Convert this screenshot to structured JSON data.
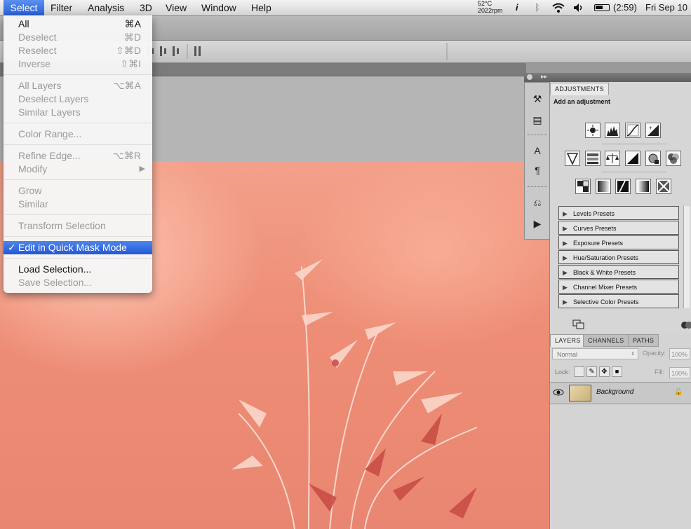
{
  "menubar": {
    "active_menu": "Select",
    "menus": [
      "Filter",
      "Analysis",
      "3D",
      "View",
      "Window",
      "Help"
    ],
    "temp": "52°C",
    "rpm": "2022rpm",
    "battery": "(2:59)",
    "clock": "Fri Sep 10"
  },
  "select_menu": {
    "items": [
      {
        "label": "All",
        "shortcut": "⌘A",
        "enabled": true
      },
      {
        "label": "Deselect",
        "shortcut": "⌘D",
        "enabled": false
      },
      {
        "label": "Reselect",
        "shortcut": "⇧⌘D",
        "enabled": false
      },
      {
        "label": "Inverse",
        "shortcut": "⇧⌘I",
        "enabled": false
      },
      {
        "label": "All Layers",
        "shortcut": "⌥⌘A",
        "enabled": false
      },
      {
        "label": "Deselect Layers",
        "shortcut": "",
        "enabled": false
      },
      {
        "label": "Similar Layers",
        "shortcut": "",
        "enabled": false
      },
      {
        "label": "Color Range...",
        "shortcut": "",
        "enabled": false
      },
      {
        "label": "Refine Edge...",
        "shortcut": "⌥⌘R",
        "enabled": false
      },
      {
        "label": "Modify",
        "shortcut": "▶",
        "enabled": false
      },
      {
        "label": "Grow",
        "shortcut": "",
        "enabled": false
      },
      {
        "label": "Similar",
        "shortcut": "",
        "enabled": false
      },
      {
        "label": "Transform Selection",
        "shortcut": "",
        "enabled": false
      },
      {
        "label": "Edit in Quick Mask Mode",
        "shortcut": "",
        "enabled": true,
        "checked": true,
        "highlighted": true
      },
      {
        "label": "Load Selection...",
        "shortcut": "",
        "enabled": true
      },
      {
        "label": "Save Selection...",
        "shortcut": "",
        "enabled": false
      }
    ]
  },
  "adjustments": {
    "tab": "ADJUSTMENTS",
    "heading": "Add an adjustment",
    "presets": [
      "Levels Presets",
      "Curves Presets",
      "Exposure Presets",
      "Hue/Saturation Presets",
      "Black & White Presets",
      "Channel Mixer Presets",
      "Selective Color Presets"
    ]
  },
  "layers": {
    "tabs": [
      "LAYERS",
      "CHANNELS",
      "PATHS"
    ],
    "blend_mode": "Normal",
    "opacity_label": "Opacity:",
    "opacity_value": "100%",
    "lock_label": "Lock:",
    "fill_label": "Fill:",
    "fill_value": "100%",
    "layer_name": "Background"
  },
  "colors": {
    "menu_highlight": "#2a62d8",
    "quick_mask_overlay": "#ee8d76"
  }
}
